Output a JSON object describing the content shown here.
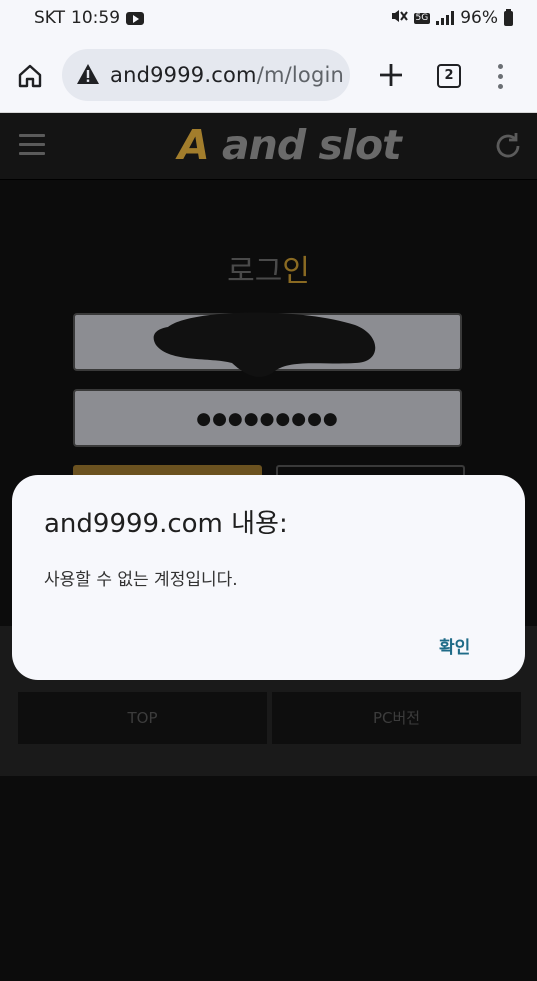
{
  "status_bar": {
    "carrier": "SKT",
    "time": "10:59",
    "network": "5G",
    "battery": "96%"
  },
  "browser": {
    "url_host": "and9999.com",
    "url_path": "/m/login",
    "tab_count": "2"
  },
  "site": {
    "logo_a": "A",
    "logo_rest": " and slot",
    "login_title_a": "로그",
    "login_title_b": "인",
    "password_mask": "●●●●●●●●●",
    "footer_buttons": [
      "TOP",
      "PC버전"
    ]
  },
  "dialog": {
    "title": "and9999.com 내용:",
    "message": "사용할 수 없는 계정입니다.",
    "confirm_label": "확인"
  },
  "colors": {
    "accent": "#a27d2c",
    "dialog_button": "#1f6b88"
  }
}
